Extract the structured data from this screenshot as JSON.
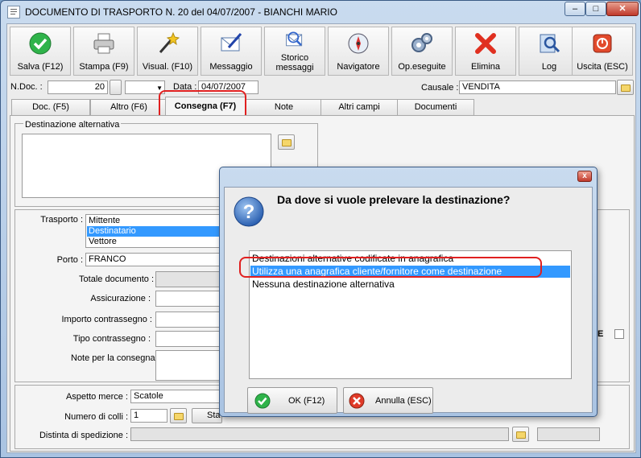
{
  "window": {
    "title": "DOCUMENTO DI TRASPORTO N. 20  del 04/07/2007 - BIANCHI MARIO",
    "minimize": "–",
    "maximize": "□",
    "close": "✕"
  },
  "toolbar": [
    {
      "label": "Salva (F12)",
      "icon": "check-icon"
    },
    {
      "label": "Stampa (F9)",
      "icon": "printer-icon"
    },
    {
      "label": "Visual. (F10)",
      "icon": "magic-wand-icon"
    },
    {
      "label": "Messaggio",
      "icon": "message-icon"
    },
    {
      "label": "Storico messaggi",
      "icon": "message-history-icon"
    },
    {
      "label": "Navigatore",
      "icon": "compass-icon"
    },
    {
      "label": "Op.eseguite",
      "icon": "gears-icon"
    },
    {
      "label": "Elimina",
      "icon": "delete-icon"
    },
    {
      "label": "Log",
      "icon": "log-icon"
    },
    {
      "label": "Uscita (ESC)",
      "icon": "exit-icon"
    }
  ],
  "header": {
    "ndoc_label": "N.Doc. :",
    "ndoc_value": "20",
    "data_label": "Data :",
    "data_value": "04/07/2007",
    "causale_label": "Causale :",
    "causale_value": "VENDITA"
  },
  "tabs": [
    {
      "label": "Doc. (F5)"
    },
    {
      "label": "Altro (F6)"
    },
    {
      "label": "Consegna (F7)"
    },
    {
      "label": "Note"
    },
    {
      "label": "Altri campi"
    },
    {
      "label": "Documenti"
    }
  ],
  "consegna": {
    "dest_alt_label": "Destinazione alternativa",
    "trasporto_label": "Trasporto :",
    "trasporto_options": [
      "Mittente",
      "Destinatario",
      "Vettore"
    ],
    "porto_label": "Porto :",
    "porto_value": "FRANCO",
    "totale_label": "Totale documento :",
    "assicurazione_label": "Assicurazione :",
    "importo_label": "Importo contrassegno :",
    "tipo_label": "Tipo contrassegno :",
    "note_label": "Note per la consegna",
    "checkbox_letter": "E",
    "aspetto_label": "Aspetto merce :",
    "aspetto_value": "Scatole",
    "colli_label": "Numero di colli :",
    "colli_value": "1",
    "sta_button": "Sta",
    "distinta_label": "Distinta di spedizione :"
  },
  "dialog": {
    "close": "x",
    "question": "Da dove si vuole prelevare la destinazione?",
    "options": [
      "Destinazioni alternative codificate in anagrafica",
      "Utilizza una anagrafica cliente/fornitore come destinazione",
      "Nessuna destinazione alternativa"
    ],
    "ok_label": "OK (F12)",
    "cancel_label": "Annulla (ESC)",
    "colors": {
      "selection": "#3399ff",
      "highlight_box": "#e02020"
    }
  }
}
